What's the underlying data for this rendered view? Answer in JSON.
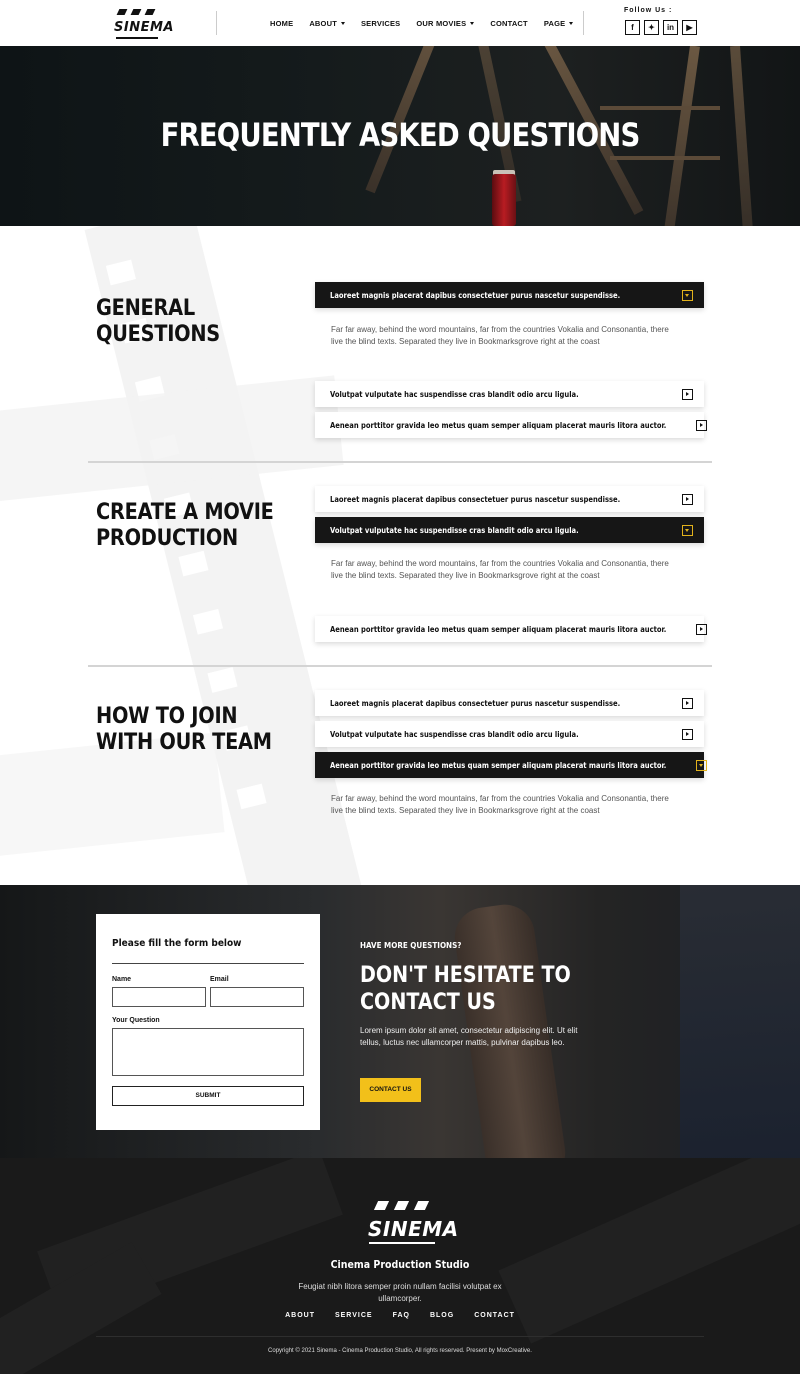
{
  "brand": {
    "name": "SINEMA"
  },
  "nav": {
    "items": [
      {
        "label": "HOME",
        "dropdown": false
      },
      {
        "label": "ABOUT",
        "dropdown": true
      },
      {
        "label": "SERVICES",
        "dropdown": false
      },
      {
        "label": "OUR MOVIES",
        "dropdown": true
      },
      {
        "label": "CONTACT",
        "dropdown": false
      },
      {
        "label": "PAGE",
        "dropdown": true
      }
    ]
  },
  "social": {
    "label": "Follow Us :",
    "icons": [
      {
        "name": "facebook-icon",
        "glyph": "f"
      },
      {
        "name": "twitter-icon",
        "glyph": "✦"
      },
      {
        "name": "linkedin-icon",
        "glyph": "in"
      },
      {
        "name": "youtube-icon",
        "glyph": "▶"
      }
    ]
  },
  "hero": {
    "title": "FREQUENTLY ASKED QUESTIONS"
  },
  "faq": {
    "answer_text": "Far far away, behind the word mountains, far from the countries Vokalia and Consonantia, there live the blind texts. Separated they live in Bookmarksgrove right at the coast",
    "sections": [
      {
        "title": "GENERAL QUESTIONS",
        "open_index": 0,
        "items": [
          "Laoreet magnis placerat dapibus consectetuer purus nascetur suspendisse.",
          "Volutpat vulputate hac suspendisse cras blandit odio arcu ligula.",
          "Aenean porttitor gravida leo metus quam semper aliquam placerat mauris litora auctor."
        ]
      },
      {
        "title": "CREATE A MOVIE PRODUCTION",
        "open_index": 1,
        "items": [
          "Laoreet magnis placerat dapibus consectetuer purus nascetur suspendisse.",
          "Volutpat vulputate hac suspendisse cras blandit odio arcu ligula.",
          "Aenean porttitor gravida leo metus quam semper aliquam placerat mauris litora auctor."
        ]
      },
      {
        "title": "HOW TO JOIN WITH OUR TEAM",
        "open_index": 2,
        "items": [
          "Laoreet magnis placerat dapibus consectetuer purus nascetur suspendisse.",
          "Volutpat vulputate hac suspendisse cras blandit odio arcu ligula.",
          "Aenean porttitor gravida leo metus quam semper aliquam placerat mauris litora auctor."
        ]
      }
    ]
  },
  "form": {
    "title": "Please fill the form below",
    "name_label": "Name",
    "email_label": "Email",
    "question_label": "Your Question",
    "submit_label": "SUBMIT"
  },
  "contact": {
    "kicker": "HAVE MORE QUESTIONS?",
    "title_line1": "DON'T HESITATE TO",
    "title_line2": "CONTACT US",
    "text": "Lorem ipsum dolor sit amet, consectetur adipiscing elit. Ut elit tellus, luctus nec ullamcorper mattis, pulvinar dapibus leo.",
    "button_label": "CONTACT US"
  },
  "footer": {
    "brand": "SINEMA",
    "title": "Cinema Production Studio",
    "description": "Feugiat nibh litora semper proin nullam facilisi volutpat ex ullamcorper.",
    "nav": [
      "ABOUT",
      "SERVICE",
      "FAQ",
      "BLOG",
      "CONTACT"
    ],
    "copyright": "Copyright © 2021 Sinema - Cinema Production Studio, All rights reserved. Present by MoxCreative."
  },
  "colors": {
    "accent": "#f2c01a",
    "dark": "#161616",
    "icon_active": "#e2b21c"
  }
}
